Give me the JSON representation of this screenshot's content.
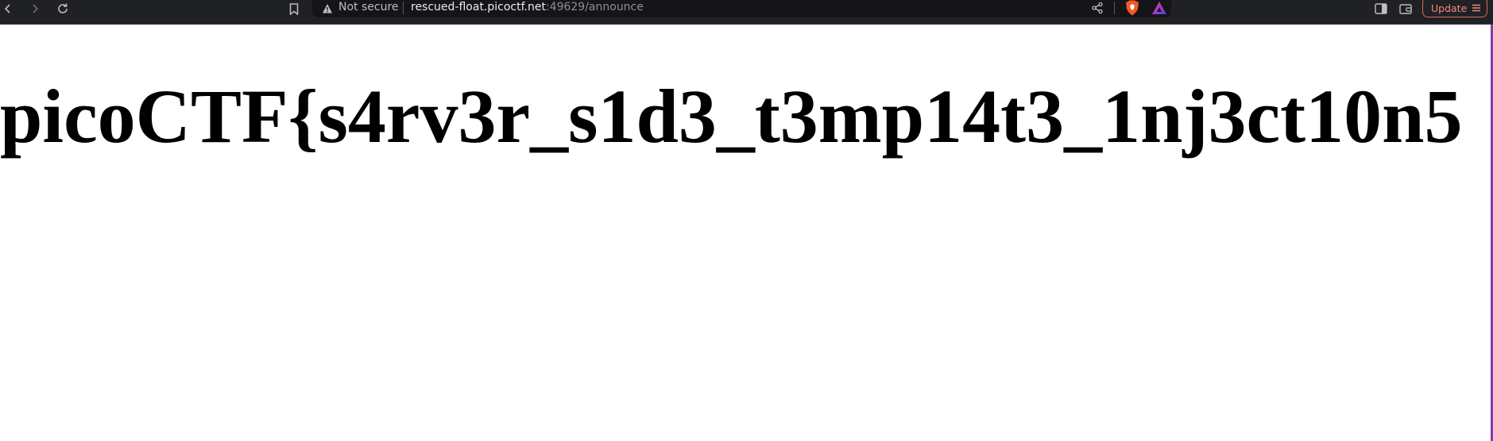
{
  "browser": {
    "address_bar": {
      "security_label": "Not secure",
      "url_host": "rescued-float.picoctf.net",
      "url_path": ":49629/announce"
    },
    "update_label": "Update",
    "icons": {
      "back": "back-arrow-icon",
      "forward": "forward-arrow-icon",
      "reload": "reload-icon",
      "bookmark": "bookmark-icon",
      "warning": "warning-icon",
      "share": "share-icon",
      "brave": "brave-shields-icon",
      "rewards": "brave-rewards-icon",
      "sidebar": "sidebar-icon",
      "wallet": "wallet-icon",
      "menu": "hamburger-menu-icon"
    },
    "colors": {
      "toolbar_bg": "#202124",
      "address_bar_bg": "#151518",
      "update_accent": "#f08a7c",
      "page_bg": "#ffffff"
    }
  },
  "page": {
    "heading": "picoCTF{s4rv3r_s1d3_t3mp14t3_1nj3ct10n5"
  }
}
